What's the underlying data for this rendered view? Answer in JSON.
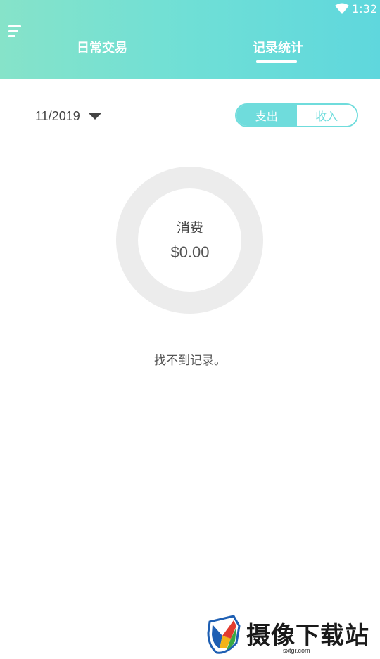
{
  "status_bar": {
    "time": "1:32",
    "wifi_icon": "wifi-icon"
  },
  "header": {
    "menu_icon": "menu-icon",
    "tabs": [
      {
        "label": "日常交易",
        "active": false
      },
      {
        "label": "记录统计",
        "active": true
      }
    ],
    "gradient_colors": [
      "#86e3c9",
      "#5fd7dd"
    ]
  },
  "filter": {
    "month": "11/2019",
    "dropdown_icon": "caret-down-icon",
    "segment": [
      {
        "label": "支出",
        "selected": true
      },
      {
        "label": "收入",
        "selected": false
      }
    ],
    "accent_color": "#6fdcdc"
  },
  "summary": {
    "label": "消费",
    "amount": "$0.00",
    "ring_color": "#ececec"
  },
  "empty_message": "找不到记录。",
  "watermark": {
    "text": "摄像下载站",
    "domain": "sxtgr.com",
    "logo_icon": "shield-logo-icon"
  }
}
